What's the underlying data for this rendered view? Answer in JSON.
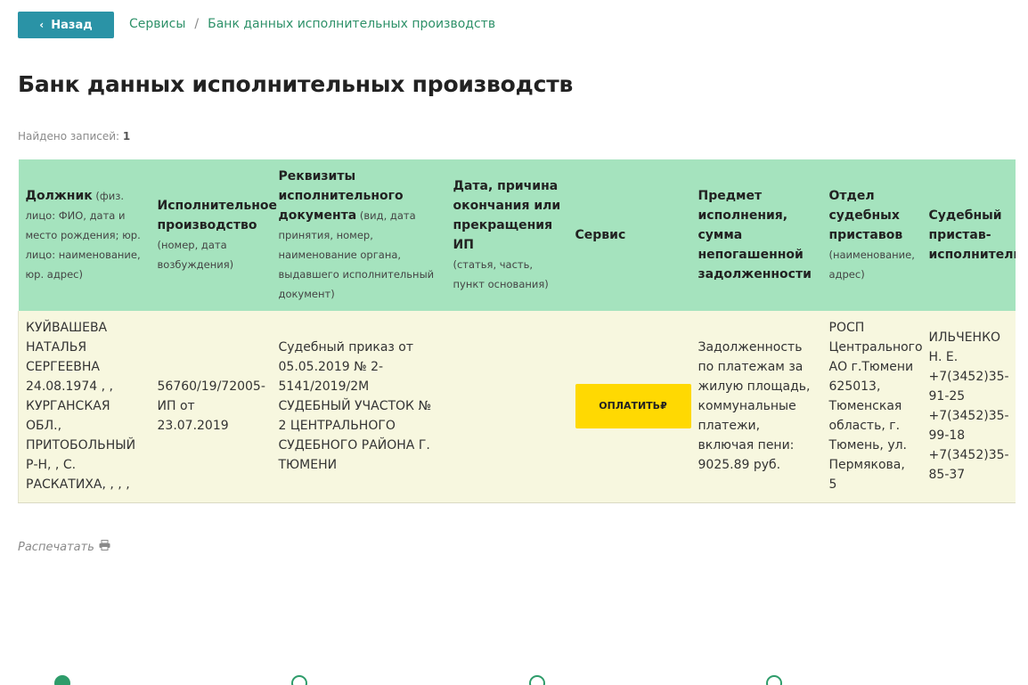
{
  "nav": {
    "back_label": "Назад",
    "breadcrumb": [
      "Сервисы",
      "Банк данных исполнительных производств"
    ]
  },
  "page": {
    "title": "Банк данных исполнительных производств",
    "found_label": "Найдено записей:",
    "found_count": "1"
  },
  "table": {
    "headers": [
      {
        "title": "Должник",
        "sub": " (физ. лицо: ФИО, дата и место рождения; юр. лицо: наименование, юр. адрес)"
      },
      {
        "title": "Исполнительное производство",
        "sub": "(номер, дата возбуждения)"
      },
      {
        "title": "Реквизиты исполнительного документа",
        "sub": " (вид, дата принятия, номер, наименование органа, выдавшего исполнительный документ)"
      },
      {
        "title": "Дата, причина окончания или прекращения ИП",
        "sub": "(статья, часть, пункт основания)"
      },
      {
        "title": "Сервис",
        "sub": ""
      },
      {
        "title": "Предмет исполнения, сумма непогашенной задолженности",
        "sub": ""
      },
      {
        "title": "Отдел судебных приставов",
        "sub": "(наименование, адрес)"
      },
      {
        "title": "Судебный пристав-исполнитель",
        "sub": ""
      }
    ],
    "row": {
      "debtor": "КУЙВАШЕВА НАТАЛЬЯ СЕРГЕЕВНА 24.08.1974 , , КУРГАНСКАЯ ОБЛ., ПРИТОБОЛЬНЫЙ Р-Н, , С. РАСКАТИХА, , , ,",
      "proceeding": "56760/19/72005-ИП от 23.07.2019",
      "document": "Судебный приказ от 05.05.2019 № 2-5141/2019/2М СУДЕБНЫЙ УЧАСТОК № 2 ЦЕНТРАЛЬНОГО СУДЕБНОГО РАЙОНА Г. ТЮМЕНИ",
      "end_date": "",
      "pay_label": "ОПЛАТИТЬ",
      "pay_currency": "₽",
      "subject": "Задолженность по платежам за жилую площадь, коммунальные платежи, включая пени: 9025.89 руб.",
      "department": "РОСП Центрального АО г.Тюмени 625013, Тюменская область, г. Тюмень, ул. Пермякова, 5",
      "bailiff_name": "ИЛЬЧЕНКО Н. Е.",
      "bailiff_phones": [
        "+7(3452)35-91-25",
        "+7(3452)35-99-18",
        "+7(3452)35-85-37"
      ]
    }
  },
  "print_label": "Распечатать",
  "colors": {
    "accent": "#2a93a6",
    "header_bg": "#a5e3be",
    "row_bg": "#f7f7df",
    "pay_button": "#ffd902",
    "link": "#2e9169"
  },
  "icons": [
    "chevron-left-icon",
    "printer-icon",
    "ruble-icon"
  ]
}
